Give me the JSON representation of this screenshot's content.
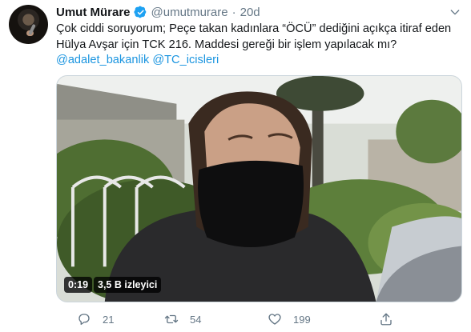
{
  "tweet": {
    "author_name": "Umut Mürare",
    "handle": "@umutmurare",
    "separator": "·",
    "time": "20d",
    "text_lines": [
      "Çok ciddi soruyorum; Peçe takan kadınlara “ÖCÜ” dediğini açıkça itiraf eden",
      "Hülya Avşar için TCK 216. Maddesi gereği bir işlem yapılacak mı?"
    ],
    "mentions": [
      "@adalet_bakanlik",
      "@TC_icisleri"
    ],
    "video": {
      "duration": "0:19",
      "views": "3,5 B izleyici"
    },
    "stats": {
      "replies": "21",
      "retweets": "54",
      "likes": "199"
    }
  },
  "colors": {
    "link": "#1b95e0",
    "secondary_text": "#657786",
    "verified": "#1da1f2"
  },
  "icons": {
    "verified": "verified-badge-icon",
    "more": "chevron-down-icon",
    "reply": "reply-icon",
    "retweet": "retweet-icon",
    "like": "heart-icon",
    "share": "share-icon"
  }
}
